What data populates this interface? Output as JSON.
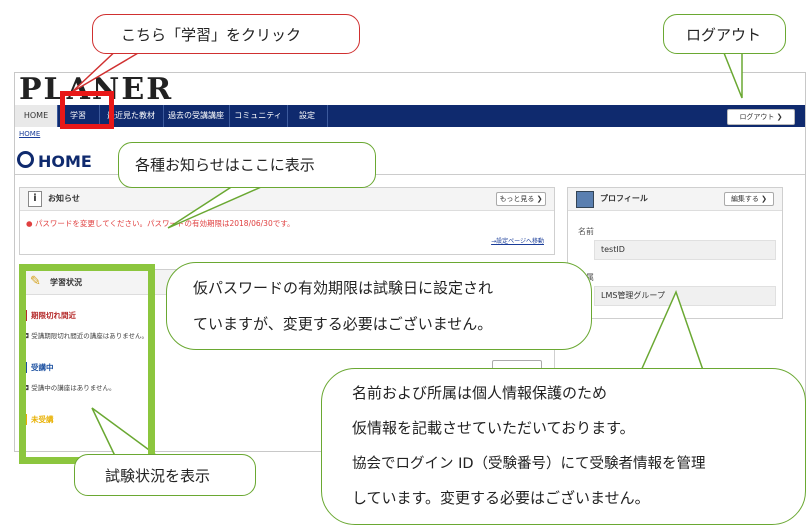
{
  "app": {
    "logo": "PLANER",
    "breadcrumb": "HOME",
    "page_title": "HOME"
  },
  "nav": {
    "items": [
      "HOME",
      "学習",
      "最近見た教材",
      "過去の受講講座",
      "コミュニティ",
      "設定"
    ],
    "logout_button": "ログアウト"
  },
  "news": {
    "title": "お知らせ",
    "more_button": "もっと見る",
    "message": "パスワードを変更してください。パスワードの有効期限は2018/06/30です。",
    "move_link": "→設定ページへ移動"
  },
  "profile": {
    "title": "プロフィール",
    "edit_button": "編集する",
    "name_label": "名前",
    "name_value": "testID",
    "affiliation_label": "所属",
    "affiliation_value": "LMS管理グループ"
  },
  "study": {
    "title": "学習状況",
    "sections": [
      {
        "heading": "期限切れ間近",
        "row": "受講期限切れ間近の講座はありません。",
        "color": "#b52a2a"
      },
      {
        "heading": "受講中",
        "row": "受講中の講座はありません。",
        "color": "#1a4fa0"
      },
      {
        "heading": "未受講",
        "row": "",
        "color": "#e8b000"
      }
    ]
  },
  "annotations": {
    "click_study": "こちら「学習」をクリック",
    "logout": "ログアウト",
    "news_here": "各種お知らせはここに表示",
    "temp_password": [
      "仮パスワードの有効期限は試験日に設定され",
      "ていますが、変更する必要はございません。"
    ],
    "privacy": [
      "名前および所属は個人情報保護のため",
      "仮情報を記載させていただいております。",
      "協会でログイン ID（受験番号）にて受験者情報を管理",
      "しています。変更する必要はございません。"
    ],
    "study_status": "試験状況を表示"
  },
  "colors": {
    "nav_bg": "#0f2a6e",
    "highlight_red": "#e81818",
    "highlight_green": "#8cc63e",
    "alert_text": "#e04040"
  },
  "icons": [
    "info-icon",
    "pencil-icon",
    "profile-icon",
    "chevron-right-icon"
  ]
}
